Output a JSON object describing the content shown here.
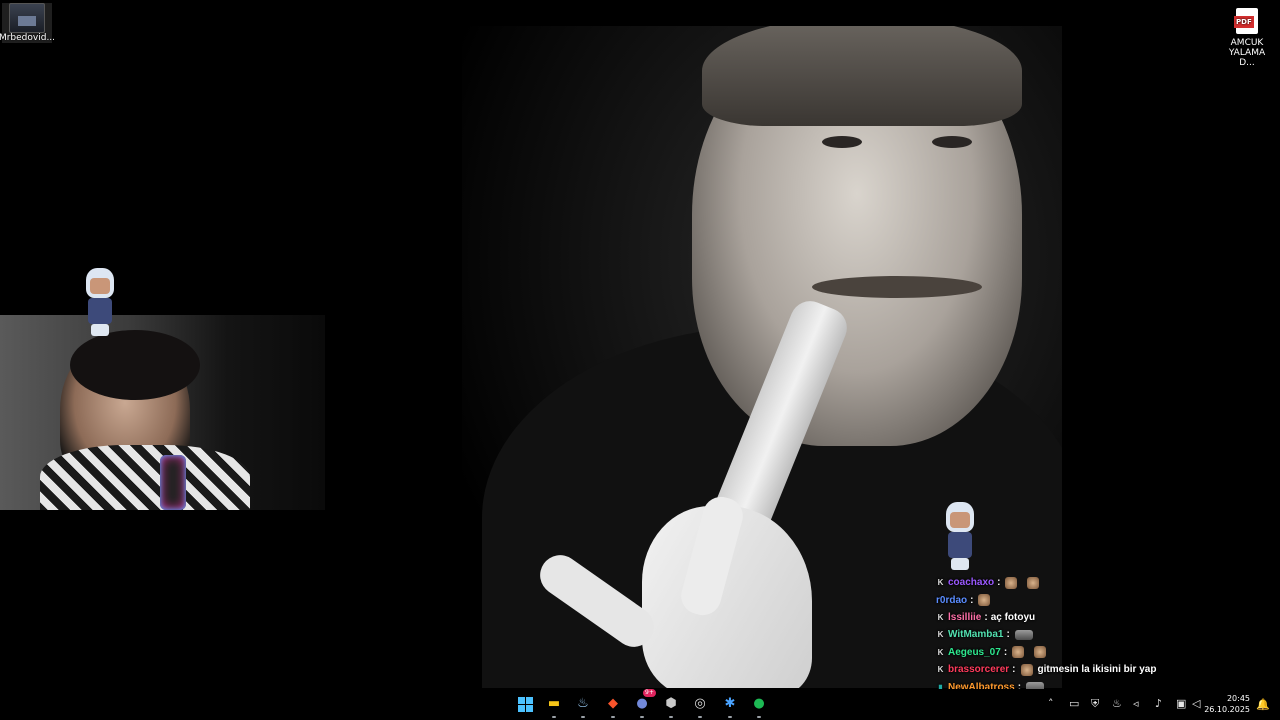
{
  "desktop": {
    "left_icon_label": "Mrbedovid...",
    "right_icon_badge": "PDF",
    "right_icon_label_1": "AMCUK",
    "right_icon_label_2": "YALAMA D..."
  },
  "chat": [
    {
      "user": "coachaxo",
      "color": "#9b59ff",
      "badge": "K",
      "message": "",
      "emotes": 2
    },
    {
      "user": "r0rdao",
      "color": "#5b8dff",
      "badge": "",
      "message": "",
      "emotes": 1
    },
    {
      "user": "lssilliie",
      "color": "#ff6fa8",
      "badge": "K",
      "message": "aç fotoyu",
      "emotes": 0
    },
    {
      "user": "WitMamba1",
      "color": "#52e0b0",
      "badge": "K",
      "message": "",
      "emotes": 1
    },
    {
      "user": "Aegeus_07",
      "color": "#2ee88f",
      "badge": "K",
      "message": "",
      "emotes": 2
    },
    {
      "user": "brassorcerer",
      "color": "#ff3b5c",
      "badge": "K",
      "message": "gitmesin la ikisini bir yap",
      "emotes": 1
    },
    {
      "user": "NewAlbatross",
      "color": "#ff9a2e",
      "badge": "▮",
      "message": "",
      "emotes": 1
    }
  ],
  "taskbar": {
    "apps": [
      "windows-start",
      "file-explorer",
      "steam",
      "brave",
      "discord",
      "epic-games",
      "obs",
      "battle-net",
      "spotify"
    ],
    "discord_badge": "9+",
    "tray_icons": [
      "chevron-up",
      "battery",
      "vpn",
      "steam",
      "speaker",
      "microphone",
      "volume",
      "network",
      "audio"
    ],
    "time": "20:45",
    "date": "26.10.2025"
  }
}
